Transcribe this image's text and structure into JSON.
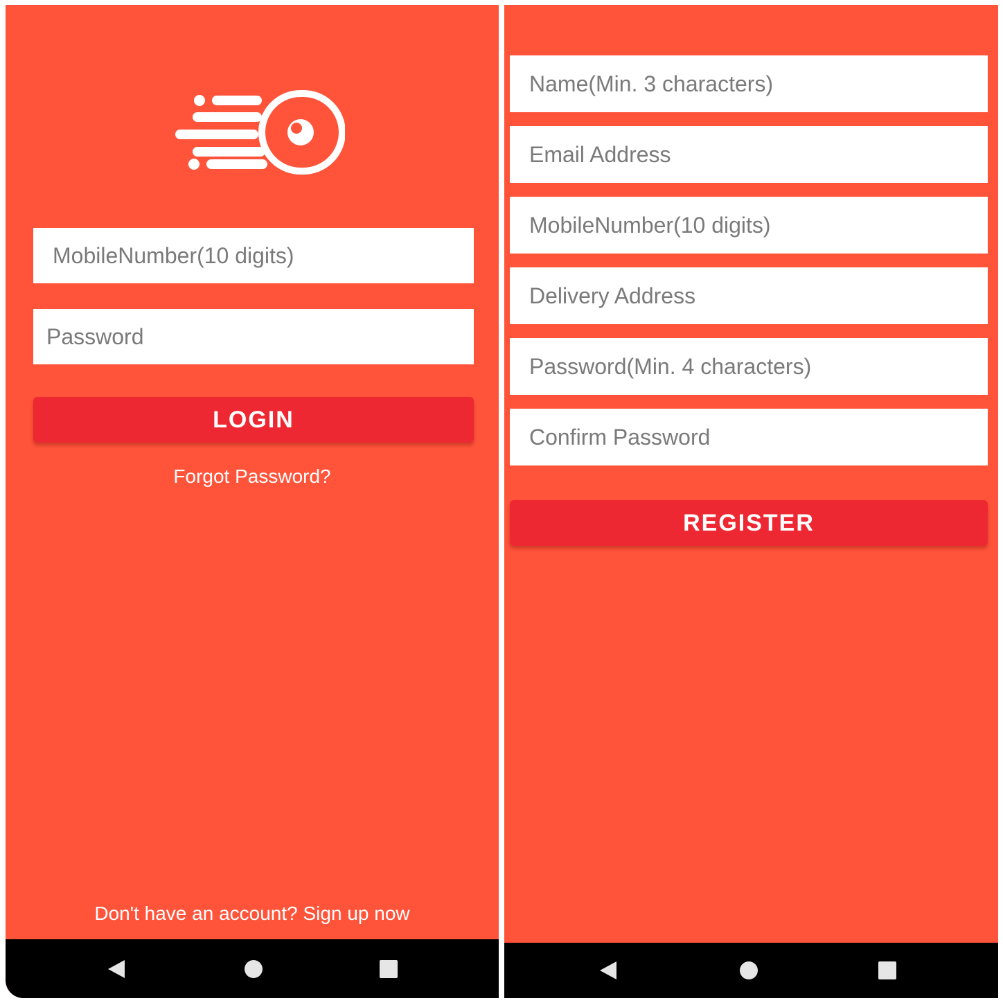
{
  "login_screen": {
    "logo_icon": "speeding-ball-logo",
    "mobile_placeholder": "MobileNumber(10 digits)",
    "password_placeholder": "Password",
    "login_label": "LOGIN",
    "forgot_password": "Forgot Password?",
    "signup_prompt": "Don't have an account? Sign up now"
  },
  "register_screen": {
    "name_placeholder": "Name(Min. 3 characters)",
    "email_placeholder": "Email Address",
    "mobile_placeholder": "MobileNumber(10 digits)",
    "address_placeholder": "Delivery Address",
    "password_placeholder": "Password(Min. 4 characters)",
    "confirm_placeholder": "Confirm Password",
    "register_label": "REGISTER"
  },
  "nav_bar": {
    "icons": [
      "back-icon",
      "home-icon",
      "recents-icon"
    ]
  },
  "colors": {
    "background": "#ff533a",
    "button": "#ee2833",
    "field": "#ffffff",
    "placeholder_text": "#7a7a7a",
    "nav_bar": "#000000"
  }
}
